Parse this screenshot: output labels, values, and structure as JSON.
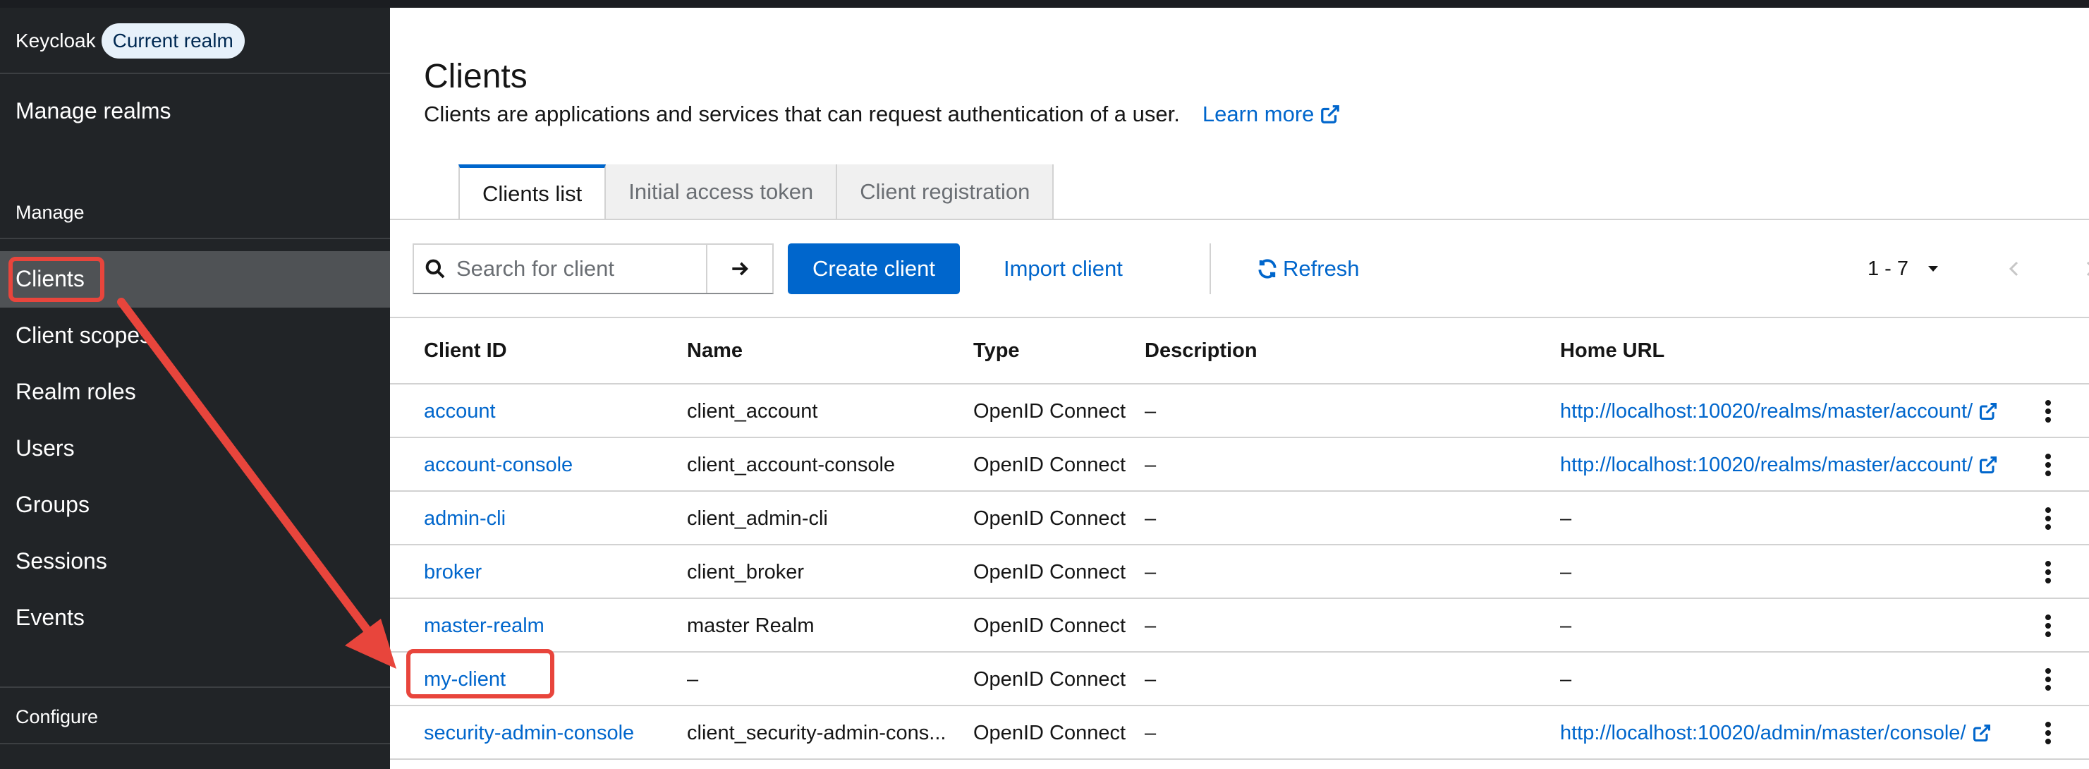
{
  "sidebar": {
    "brand": "Keycloak",
    "realm_badge": "Current realm",
    "manage_realms": "Manage realms",
    "section_manage": "Manage",
    "items": [
      {
        "label": "Clients"
      },
      {
        "label": "Client scopes"
      },
      {
        "label": "Realm roles"
      },
      {
        "label": "Users"
      },
      {
        "label": "Groups"
      },
      {
        "label": "Sessions"
      },
      {
        "label": "Events"
      }
    ],
    "section_configure": "Configure"
  },
  "page": {
    "title": "Clients",
    "description": "Clients are applications and services that can request authentication of a user.",
    "learn_more": "Learn more"
  },
  "tabs": [
    {
      "label": "Clients list"
    },
    {
      "label": "Initial access token"
    },
    {
      "label": "Client registration"
    }
  ],
  "toolbar": {
    "search_placeholder": "Search for client",
    "create": "Create client",
    "import": "Import client",
    "refresh": "Refresh",
    "pagination": "1 - 7"
  },
  "table": {
    "headers": [
      "Client ID",
      "Name",
      "Type",
      "Description",
      "Home URL"
    ],
    "rows": [
      {
        "client_id": "account",
        "name": "client_account",
        "type": "OpenID Connect",
        "description": "–",
        "home_url": "http://localhost:10020/realms/master/account/"
      },
      {
        "client_id": "account-console",
        "name": "client_account-console",
        "type": "OpenID Connect",
        "description": "–",
        "home_url": "http://localhost:10020/realms/master/account/"
      },
      {
        "client_id": "admin-cli",
        "name": "client_admin-cli",
        "type": "OpenID Connect",
        "description": "–",
        "home_url": "–"
      },
      {
        "client_id": "broker",
        "name": "client_broker",
        "type": "OpenID Connect",
        "description": "–",
        "home_url": "–"
      },
      {
        "client_id": "master-realm",
        "name": "master Realm",
        "type": "OpenID Connect",
        "description": "–",
        "home_url": "–"
      },
      {
        "client_id": "my-client",
        "name": "–",
        "type": "OpenID Connect",
        "description": "–",
        "home_url": "–"
      },
      {
        "client_id": "security-admin-console",
        "name": "client_security-admin-cons...",
        "type": "OpenID Connect",
        "description": "–",
        "home_url": "http://localhost:10020/admin/master/console/"
      }
    ]
  },
  "colors": {
    "sidebar_bg": "#212427",
    "sidebar_active": "#4f5255",
    "accent": "#0066cc",
    "annotation": "#e8453c"
  }
}
